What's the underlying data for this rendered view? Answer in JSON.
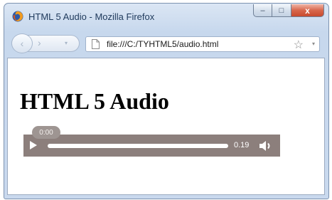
{
  "window": {
    "title": "HTML 5 Audio - Mozilla Firefox",
    "minimize_label": "–",
    "maximize_label": "□",
    "close_label": "x"
  },
  "navbar": {
    "back_glyph": "‹",
    "forward_glyph": "›",
    "url": "file:///C:/TYHTML5/audio.html",
    "bookmark_glyph": "☆",
    "dropdown_glyph": "▾"
  },
  "page": {
    "heading": "HTML 5 Audio"
  },
  "audio_player": {
    "current_time": "0:00",
    "duration": "0.19",
    "progress": 0
  },
  "colors": {
    "player_bg": "#8c7f7c",
    "close_button": "#c84a2d",
    "titlebar": "#c7d8ed"
  },
  "icons": [
    "firefox-icon",
    "back-arrow-icon",
    "forward-arrow-icon",
    "page-icon",
    "bookmark-star-icon",
    "play-icon",
    "volume-icon"
  ]
}
